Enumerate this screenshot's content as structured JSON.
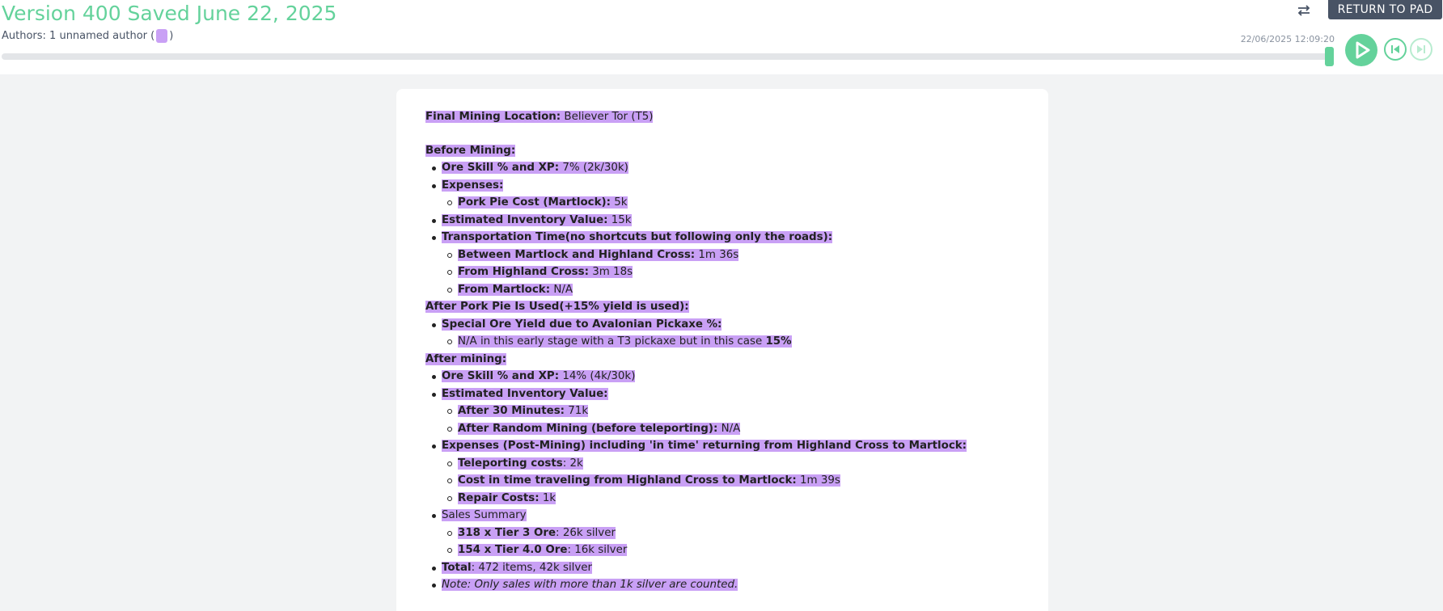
{
  "header": {
    "title": "Version 400 Saved June 22, 2025",
    "authors_prefix": "Authors: 1 unnamed author (",
    "authors_suffix": ")",
    "return_label": "RETURN TO PAD",
    "timestamp": "22/06/2025 12:09:20",
    "slider_position_fraction": 0.999
  },
  "icons": {
    "swap": "swap-arrows-icon",
    "play": "play-icon",
    "prev": "step-back-icon",
    "next": "step-forward-icon"
  },
  "colors": {
    "accent": "#64d29b",
    "highlight": "#c9a0f5",
    "button": "#485365"
  },
  "doc": {
    "l0": {
      "k": "Final Mining Location:",
      "v": " Believer Tor (T5)"
    },
    "l1": {
      "k": "Before Mining:"
    },
    "l2": {
      "k": "Ore Skill % and XP:",
      "v": " 7% (2k/30k)"
    },
    "l3": {
      "k": "Expenses:"
    },
    "l4": {
      "k": "Pork Pie Cost (Martlock):",
      "v": " 5k"
    },
    "l5": {
      "k": "Estimated Inventory Value:",
      "v": " 15k"
    },
    "l6": {
      "k": "Transportation Time(no shortcuts but following only the roads):"
    },
    "l7": {
      "k": "Between Martlock and Highland Cross:",
      "v": " 1m 36s"
    },
    "l8": {
      "k": "From Highland Cross:",
      "v": " 3m 18s"
    },
    "l9": {
      "k": "From Martlock:",
      "v": " N/A"
    },
    "l10": {
      "k": "After Pork Pie Is Used(+15% yield is used):"
    },
    "l11": {
      "k": "Special Ore Yield due to Avalonian Pickaxe %:"
    },
    "l12": {
      "v": "N/A in this early stage with a T3 pickaxe but in this case ",
      "k": "15%",
      "tail": " "
    },
    "l13": {
      "k": "After mining:"
    },
    "l14": {
      "k": "Ore Skill % and XP:",
      "v": " 14% (4k/30k)"
    },
    "l15": {
      "k": "Estimated Inventory Value:"
    },
    "l16": {
      "k": "After 30 Minutes:",
      "v": " 71k"
    },
    "l17": {
      "k": "After Random Mining (before teleporting):",
      "v": " N/A"
    },
    "l18": {
      "k": "Expenses (Post-Mining) including 'in time' returning from Highland Cross to Martlock:"
    },
    "l19": {
      "k": "Teleporting costs",
      "v": ": 2k"
    },
    "l20": {
      "k": "Cost in time traveling from Highland Cross to Martlock:",
      "v": " 1m 39s"
    },
    "l21": {
      "k": "Repair Costs:",
      "v": " 1k"
    },
    "l22": {
      "v": "Sales Summary"
    },
    "l23": {
      "k": "318 x Tier 3 Ore",
      "v": ": 26k silver"
    },
    "l24": {
      "k": "154 x Tier 4.0 Ore",
      "v": ": 16k silver"
    },
    "l25": {
      "k": "Total",
      "v": ": 472 items, 42k silver"
    },
    "l26": {
      "v": "Note: Only sales with more than 1k silver are counted."
    }
  }
}
